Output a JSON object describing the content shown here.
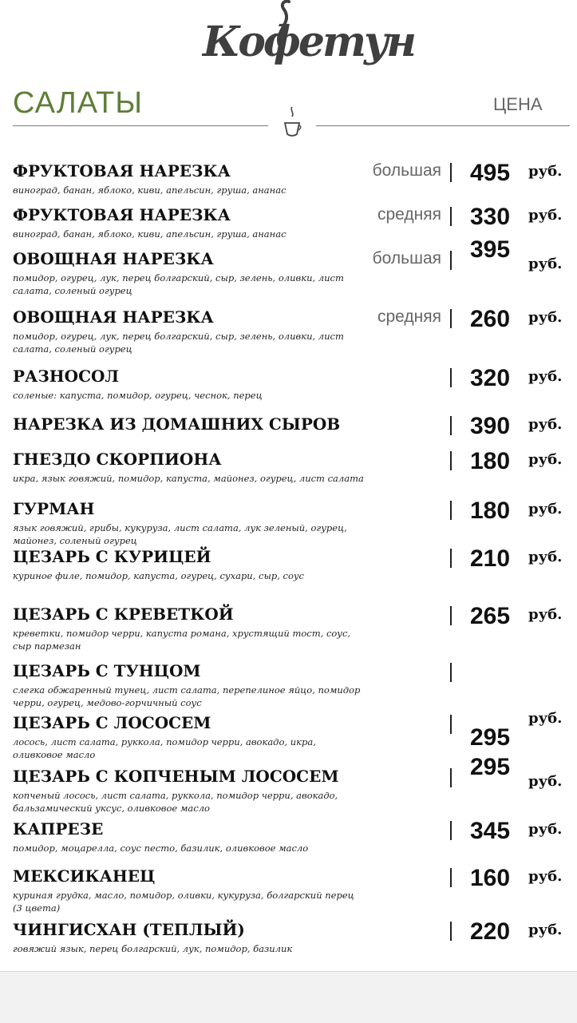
{
  "header": {
    "logo_text": "Кофетун",
    "section_title": "САЛАТЫ",
    "price_column": "ЦЕНА"
  },
  "currency": "руб.",
  "colors": {
    "accent": "#5f7d3a",
    "text": "#111111",
    "muted": "#666666"
  },
  "items": [
    {
      "name": "ФРУКТОВАЯ НАРЕЗКА",
      "desc": "виноград, банан, яблоко, киви, апельсин, груша, ананас",
      "size": "большая",
      "price": "495"
    },
    {
      "name": "ФРУКТОВАЯ НАРЕЗКА",
      "desc": "виноград, банан, яблоко, киви, апельсин, груша, ананас",
      "size": "средняя",
      "price": "330"
    },
    {
      "name": "ОВОЩНАЯ НАРЕЗКА",
      "desc": "помидор, огурец, лук, перец болгарский, сыр, зелень, оливки, лист салата, соленый огурец",
      "size": "большая",
      "price": "395"
    },
    {
      "name": "ОВОЩНАЯ НАРЕЗКА",
      "desc": "помидор, огурец, лук, перец болгарский, сыр, зелень, оливки, лист салата, соленый огурец",
      "size": "средняя",
      "price": "260"
    },
    {
      "name": "РАЗНОСОЛ",
      "desc": "соленые: капуста, помидор, огурец, чеснок, перец",
      "size": "",
      "price": "320"
    },
    {
      "name": "НАРЕЗКА ИЗ ДОМАШНИХ СЫРОВ",
      "desc": "",
      "size": "",
      "price": "390"
    },
    {
      "name": "ГНЕЗДО СКОРПИОНА",
      "desc": "икра, язык говяжий, помидор, капуста, майонез, огурец, лист салата",
      "size": "",
      "price": "180"
    },
    {
      "name": "ГУРМАН",
      "desc": "язык говяжий, грибы, кукуруза, лист салата, лук зеленый, огурец, майонез, соленый огурец",
      "size": "",
      "price": "180"
    },
    {
      "name": "ЦЕЗАРЬ С КУРИЦЕЙ",
      "desc": "куриное филе, помидор, капуста, огурец, сухари, сыр, соус",
      "size": "",
      "price": "210"
    },
    {
      "name": "ЦЕЗАРЬ С КРЕВЕТКОЙ",
      "desc": "креветки, помидор черри, капуста романа, хрустящий тост, соус, сыр пармезан",
      "size": "",
      "price": "265"
    },
    {
      "name": "ЦЕЗАРЬ С ТУНЦОМ",
      "desc": "слегка обжаренный тунец, лист салата, перепелиное яйцо, помидор черри, огурец, медово-горчичный соус",
      "size": "",
      "price": ""
    },
    {
      "name": "ЦЕЗАРЬ С ЛОСОСЕМ",
      "desc": "лосось, лист салата, руккола, помидор черри, авокадо, икра, оливковое масло",
      "size": "",
      "price": "295"
    },
    {
      "name": "ЦЕЗАРЬ С КОПЧЕНЫМ ЛОСОСЕМ",
      "desc": "копченый лосось, лист салата, руккола, помидор черри, авокадо, бальзамический уксус, оливковое масло",
      "size": "",
      "price": "295"
    },
    {
      "name": "КАПРЕЗЕ",
      "desc": "помидор, моцарелла, соус песто, базилик, оливковое масло",
      "size": "",
      "price": "345"
    },
    {
      "name": "МЕКСИКАНЕЦ",
      "desc": "куриная грудка, масло, помидор, оливки, кукуруза, болгарский перец (3 цвета)",
      "size": "",
      "price": "160"
    },
    {
      "name": "ЧИНГИСХАН (ТЕПЛЫЙ)",
      "desc": "говяжий язык, перец болгарский, лук, помидор, базилик",
      "size": "",
      "price": "220"
    }
  ]
}
